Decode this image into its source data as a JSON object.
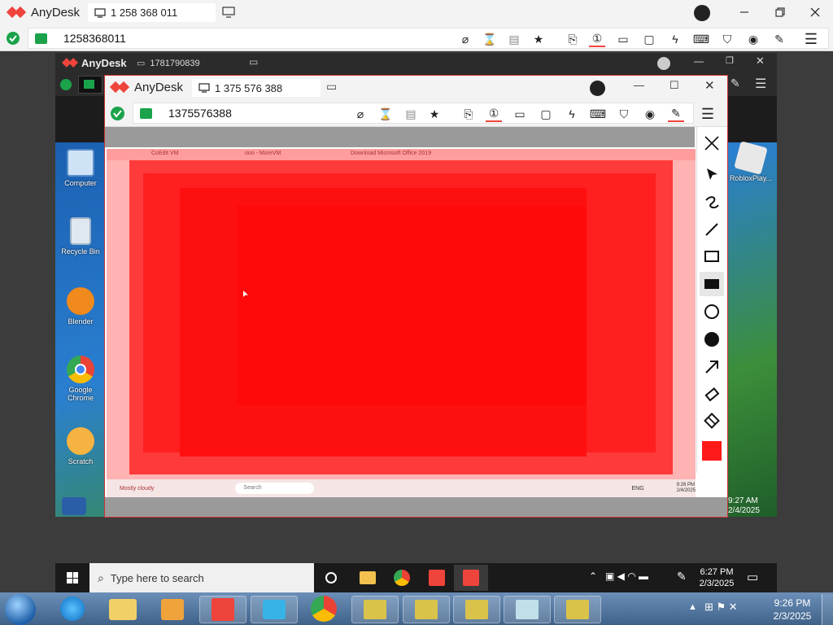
{
  "outer": {
    "app_name": "AnyDesk",
    "tab_id": "1 258 368 011",
    "address_value": "1258368011"
  },
  "mid": {
    "app_name": "AnyDesk",
    "tab_id": "1781790839"
  },
  "inner": {
    "app_name": "AnyDesk",
    "tab_id": "1 375 576 388",
    "address_value": "1375576388"
  },
  "desktop_icons": [
    {
      "label": "Computer"
    },
    {
      "label": "Recycle Bin"
    },
    {
      "label": "Blender"
    },
    {
      "label": "Google Chrome"
    },
    {
      "label": "Scratch"
    }
  ],
  "right_desktop_icon": {
    "label": "RobloxPlay..."
  },
  "remote_clock": {
    "time": "9:27 AM",
    "date": "2/4/2025"
  },
  "mid_taskbar": {
    "search_placeholder": "Type here to search",
    "time": "6:27 PM",
    "date": "2/3/2025"
  },
  "outer_taskbar": {
    "time": "9:26 PM",
    "date": "2/3/2025"
  },
  "remote_screen": {
    "tabs": [
      "CoEdit VM",
      "ooo - MoreVM",
      "Download Microsoft Office 2019"
    ],
    "weather": "Mostly cloudy",
    "search": "Search",
    "lang": "ENG",
    "time": "9:26 PM",
    "date": "2/4/2025"
  },
  "draw_tools": [
    "close-icon",
    "pointer-icon",
    "freehand-icon",
    "line-icon",
    "rect-outline-icon",
    "rect-filled-icon",
    "circle-outline-icon",
    "circle-filled-icon",
    "arrow-icon",
    "eraser-icon",
    "clear-icon",
    "color-swatch"
  ],
  "colors": {
    "accent_red": "#ef443b",
    "overlay_red": "#ff1a1a",
    "check_green": "#1aa34a"
  }
}
